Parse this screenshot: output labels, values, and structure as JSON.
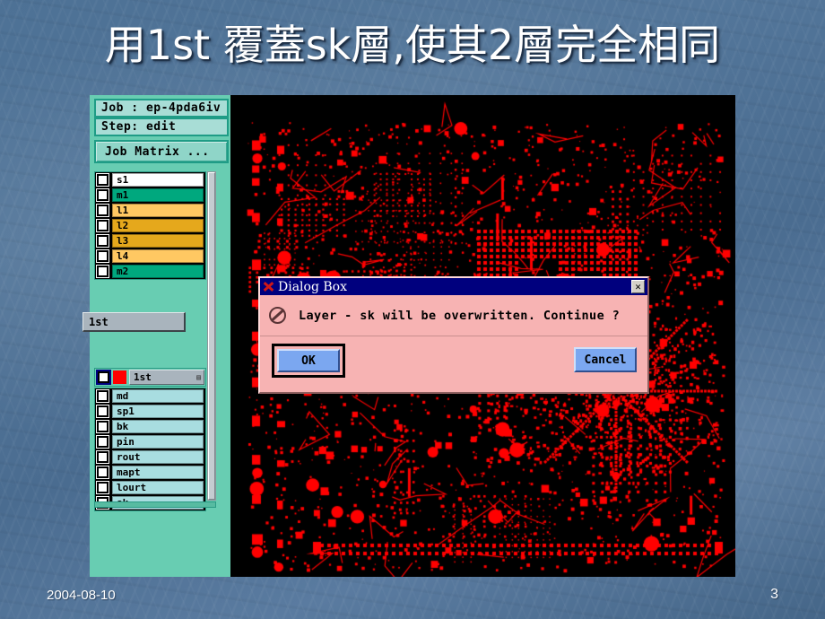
{
  "slide": {
    "title": "用1st 覆蓋sk層,使其2層完全相同",
    "footer_date": "2004-08-10",
    "page_number": "3",
    "background_color": "#4d7195"
  },
  "app": {
    "job_field": "Job : ep-4pda6iv",
    "step_field": "Step: edit",
    "job_matrix_button": "Job Matrix ...",
    "tooltip": "1st",
    "layers_upper": [
      {
        "name": "s1",
        "color": "#ffffff",
        "checked": false
      },
      {
        "name": "m1",
        "color": "#00a87e",
        "checked": false
      },
      {
        "name": "l1",
        "color": "#ffc862",
        "checked": false
      },
      {
        "name": "l2",
        "color": "#e5a81c",
        "checked": false
      },
      {
        "name": "l3",
        "color": "#e5a81c",
        "checked": false
      },
      {
        "name": "l4",
        "color": "#ffc862",
        "checked": false
      },
      {
        "name": "m2",
        "color": "#00a87e",
        "checked": false
      }
    ],
    "selected_layer": {
      "name": "1st",
      "color": "#ff0000",
      "grip": "▤"
    },
    "layers_lower": [
      {
        "name": "md",
        "color": "#a8dde0",
        "checked": false
      },
      {
        "name": "sp1",
        "color": "#a8dde0",
        "checked": false
      },
      {
        "name": "bk",
        "color": "#a8dde0",
        "checked": false
      },
      {
        "name": "pin",
        "color": "#a8dde0",
        "checked": false
      },
      {
        "name": "rout",
        "color": "#a8dde0",
        "checked": false
      },
      {
        "name": "mapt",
        "color": "#a8dde0",
        "checked": false
      },
      {
        "name": "lourt",
        "color": "#a8dde0",
        "checked": false
      },
      {
        "name": "sk",
        "color": "#a8dde0",
        "checked": false
      }
    ],
    "canvas": {
      "background_color": "#000000",
      "trace_color": "#ff0000",
      "description": "PCB layer view"
    }
  },
  "dialog": {
    "title": "Dialog Box",
    "close_label": "✕",
    "message": "Layer - sk will be overwritten. Continue ?",
    "ok_label": "OK",
    "cancel_label": "Cancel",
    "background_color": "#f7b3b3",
    "titlebar_color": "#00007e"
  }
}
